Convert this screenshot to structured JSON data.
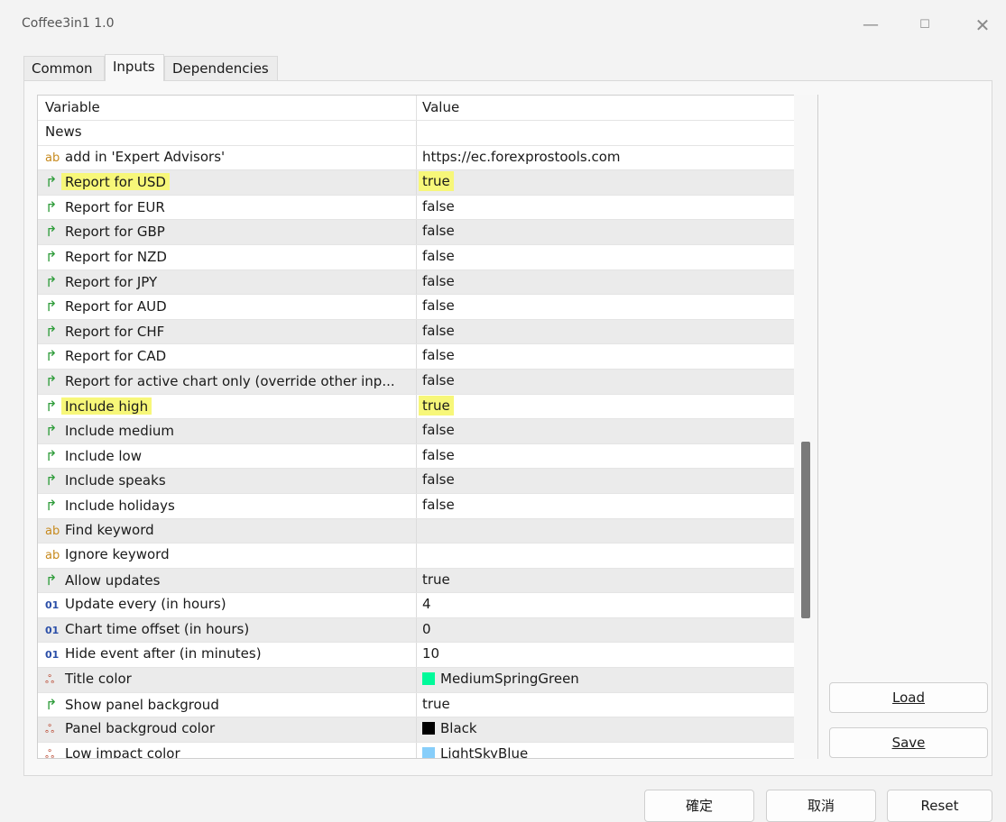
{
  "window": {
    "title": "Coffee3in1 1.0",
    "minimize_glyph": "—",
    "maximize_glyph": "☐",
    "close_glyph": "✕"
  },
  "tabs": [
    {
      "label": "Common"
    },
    {
      "label": "Inputs",
      "active": true
    },
    {
      "label": "Dependencies"
    }
  ],
  "grid": {
    "headers": {
      "variable": "Variable",
      "value": "Value"
    },
    "rows": [
      {
        "type": "group",
        "label": "News",
        "value": ""
      },
      {
        "type": "ab",
        "label": "add in 'Expert Advisors'",
        "value": "https://ec.forexprostools.com"
      },
      {
        "type": "bool",
        "label": "Report for USD",
        "value": "true",
        "highlight": true
      },
      {
        "type": "bool",
        "label": "Report for EUR",
        "value": "false"
      },
      {
        "type": "bool",
        "label": "Report for GBP",
        "value": "false"
      },
      {
        "type": "bool",
        "label": "Report for NZD",
        "value": "false"
      },
      {
        "type": "bool",
        "label": "Report for JPY",
        "value": "false"
      },
      {
        "type": "bool",
        "label": "Report for AUD",
        "value": "false"
      },
      {
        "type": "bool",
        "label": "Report for CHF",
        "value": "false"
      },
      {
        "type": "bool",
        "label": "Report for CAD",
        "value": "false"
      },
      {
        "type": "bool",
        "label": "Report for active chart only (override other inp...",
        "value": "false"
      },
      {
        "type": "bool",
        "label": "Include high",
        "value": "true",
        "highlight": true
      },
      {
        "type": "bool",
        "label": "Include medium",
        "value": "false"
      },
      {
        "type": "bool",
        "label": "Include low",
        "value": "false"
      },
      {
        "type": "bool",
        "label": "Include speaks",
        "value": "false"
      },
      {
        "type": "bool",
        "label": "Include holidays",
        "value": "false"
      },
      {
        "type": "ab",
        "label": "Find keyword",
        "value": ""
      },
      {
        "type": "ab",
        "label": "Ignore keyword",
        "value": ""
      },
      {
        "type": "bool",
        "label": "Allow updates",
        "value": "true"
      },
      {
        "type": "num",
        "label": "Update every (in hours)",
        "value": "4"
      },
      {
        "type": "num",
        "label": "Chart time offset (in hours)",
        "value": "0"
      },
      {
        "type": "num",
        "label": "Hide event after (in minutes)",
        "value": "10"
      },
      {
        "type": "color",
        "label": "Title color",
        "value": "MediumSpringGreen",
        "swatch": "#00fa9a"
      },
      {
        "type": "bool",
        "label": "Show panel backgroud",
        "value": "true"
      },
      {
        "type": "color",
        "label": "Panel backgroud color",
        "value": "Black",
        "swatch": "#000000"
      },
      {
        "type": "color",
        "label": "Low impact color",
        "value": "LightSkyBlue",
        "swatch": "#87cefa"
      }
    ]
  },
  "icons": {
    "ab": "ab",
    "bool": "↱",
    "num": "01",
    "color": "ஃ"
  },
  "side_buttons": {
    "load": "Load",
    "save": "Save"
  },
  "bottom_buttons": {
    "ok": "確定",
    "cancel": "取消",
    "reset": "Reset"
  },
  "colors": {
    "highlight": "#f7f779",
    "bool_icon": "#2e9c3a",
    "ab_icon": "#c78a1e"
  }
}
